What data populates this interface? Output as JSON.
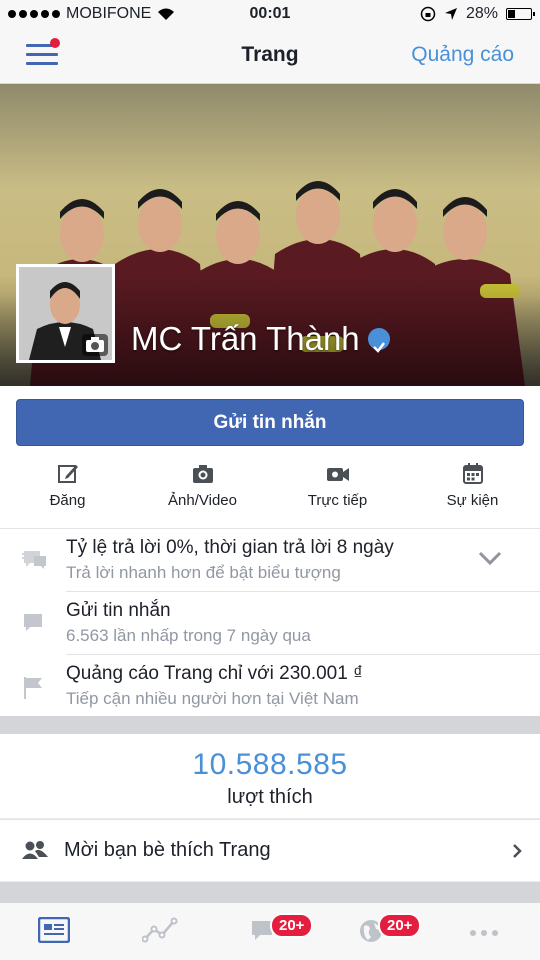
{
  "status_bar": {
    "carrier": "MOBIFONE",
    "time": "00:01",
    "battery": "28%",
    "battery_level": 0.28
  },
  "nav": {
    "title": "Trang",
    "right_link": "Quảng cáo"
  },
  "page": {
    "name": "MC Trấn Thành"
  },
  "primary_action": {
    "label": "Gửi tin nhắn"
  },
  "actions": [
    {
      "label": "Đăng",
      "icon": "compose-icon"
    },
    {
      "label": "Ảnh/Video",
      "icon": "camera-icon"
    },
    {
      "label": "Trực tiếp",
      "icon": "live-video-icon"
    },
    {
      "label": "Sự kiện",
      "icon": "calendar-icon"
    }
  ],
  "insights": [
    {
      "title": "Tỷ lệ trả lời 0%, thời gian trả lời 8 ngày",
      "subtitle": "Trả lời nhanh hơn để bật biểu tượng",
      "icon": "response-icon"
    },
    {
      "title": "Gửi tin nhắn",
      "subtitle": "6.563 lần nhấp trong 7 ngày qua",
      "icon": "message-icon"
    },
    {
      "title": "Quảng cáo Trang chỉ với 230.001 ₫",
      "subtitle": "Tiếp cận nhiều người hơn tại Việt Nam",
      "icon": "flag-icon"
    }
  ],
  "likes": {
    "count": "10.588.585",
    "label": "lượt thích"
  },
  "invite": {
    "label": "Mời bạn bè thích Trang"
  },
  "tab_bar": {
    "tabs": [
      {
        "icon": "page-icon",
        "active": true
      },
      {
        "icon": "insights-icon"
      },
      {
        "icon": "messages-icon",
        "badge": "20+"
      },
      {
        "icon": "notifications-globe-icon",
        "badge": "20+"
      },
      {
        "icon": "more-icon"
      }
    ]
  },
  "colors": {
    "brand": "#4267b2",
    "link": "#4a90d9",
    "badge": "#e41e3f"
  }
}
